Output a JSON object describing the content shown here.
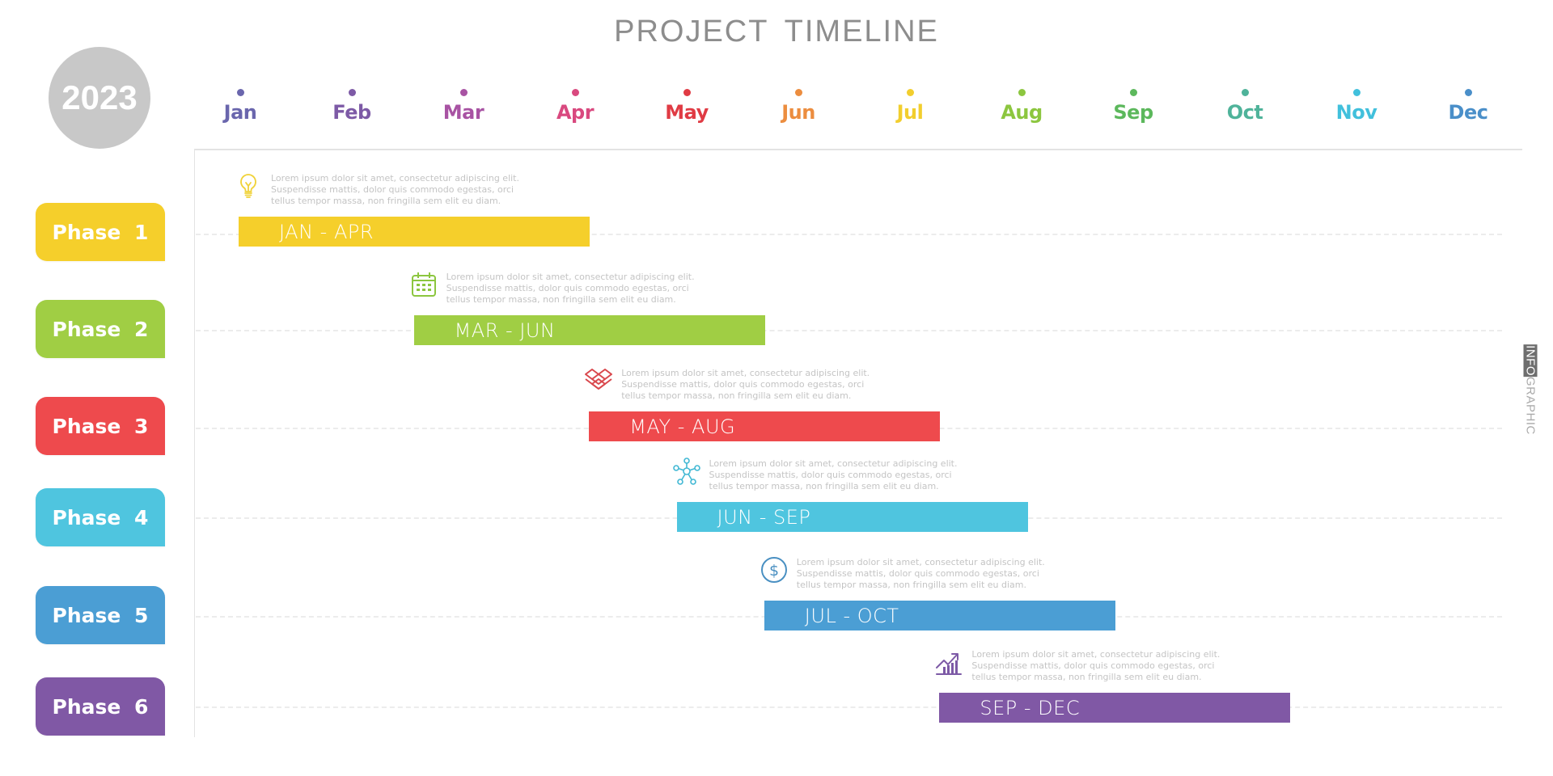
{
  "title": "PROJECT  TIMELINE",
  "year": "2023",
  "side_tag": {
    "highlight": "INFO",
    "rest": "GRAPHIC"
  },
  "months": [
    {
      "label": "Jan",
      "color": "#6a66ad"
    },
    {
      "label": "Feb",
      "color": "#7d5aa6"
    },
    {
      "label": "Mar",
      "color": "#a853a3"
    },
    {
      "label": "Apr",
      "color": "#d9497f"
    },
    {
      "label": "May",
      "color": "#e03b44"
    },
    {
      "label": "Jun",
      "color": "#ec8d3f"
    },
    {
      "label": "Jul",
      "color": "#f2ce2e"
    },
    {
      "label": "Aug",
      "color": "#8cc63f"
    },
    {
      "label": "Sep",
      "color": "#5cb85c"
    },
    {
      "label": "Oct",
      "color": "#4fb39a"
    },
    {
      "label": "Nov",
      "color": "#41c0dc"
    },
    {
      "label": "Dec",
      "color": "#4a8fc9"
    }
  ],
  "phases": [
    {
      "label": "Phase  1",
      "range_label": "JAN - APR",
      "start_month": 1,
      "end_month": 4,
      "color": "#f5cf2b",
      "icon": "lightbulb-icon",
      "icon_color": "#f0d23a",
      "description": [
        "Lorem ipsum dolor sit amet, consectetur adipiscing elit.",
        "Suspendisse mattis, dolor quis commodo egestas, orci",
        "tellus tempor massa, non fringilla sem elit eu diam."
      ]
    },
    {
      "label": "Phase  2",
      "range_label": "MAR - JUN",
      "start_month": 3,
      "end_month": 6,
      "color": "#a0ce44",
      "icon": "calendar-icon",
      "icon_color": "#8cc63f",
      "description": [
        "Lorem ipsum dolor sit amet, consectetur adipiscing elit.",
        "Suspendisse mattis, dolor quis commodo egestas, orci",
        "tellus tempor massa, non fringilla sem elit eu diam."
      ]
    },
    {
      "label": "Phase  3",
      "range_label": "MAY - AUG",
      "start_month": 5,
      "end_month": 8,
      "color": "#ee4a4d",
      "icon": "layers-icon",
      "icon_color": "#d9474c",
      "description": [
        "Lorem ipsum dolor sit amet, consectetur adipiscing elit.",
        "Suspendisse mattis, dolor quis commodo egestas, orci",
        "tellus tempor massa, non fringilla sem elit eu diam."
      ]
    },
    {
      "label": "Phase  4",
      "range_label": "JUN - SEP",
      "start_month": 6,
      "end_month": 9,
      "color": "#4fc5df",
      "icon": "network-icon",
      "icon_color": "#41b8d4",
      "description": [
        "Lorem ipsum dolor sit amet, consectetur adipiscing elit.",
        "Suspendisse mattis, dolor quis commodo egestas, orci",
        "tellus tempor massa, non fringilla sem elit eu diam."
      ]
    },
    {
      "label": "Phase  5",
      "range_label": "JUL - OCT",
      "start_month": 7,
      "end_month": 10,
      "color": "#4b9ed4",
      "icon": "dollar-icon",
      "icon_color": "#4a90c2",
      "description": [
        "Lorem ipsum dolor sit amet, consectetur adipiscing elit.",
        "Suspendisse mattis, dolor quis commodo egestas, orci",
        "tellus tempor massa, non fringilla sem elit eu diam."
      ]
    },
    {
      "label": "Phase  6",
      "range_label": "SEP - DEC",
      "start_month": 9,
      "end_month": 12,
      "color": "#8058a5",
      "icon": "growth-chart-icon",
      "icon_color": "#7d5aa6",
      "description": [
        "Lorem ipsum dolor sit amet, consectetur adipiscing elit.",
        "Suspendisse mattis, dolor quis commodo egestas, orci",
        "tellus tempor massa, non fringilla sem elit eu diam."
      ]
    }
  ],
  "chart_data": {
    "type": "gantt",
    "title": "PROJECT TIMELINE",
    "year": "2023",
    "x": [
      "Jan",
      "Feb",
      "Mar",
      "Apr",
      "May",
      "Jun",
      "Jul",
      "Aug",
      "Sep",
      "Oct",
      "Nov",
      "Dec"
    ],
    "categories": [
      "Phase 1",
      "Phase 2",
      "Phase 3",
      "Phase 4",
      "Phase 5",
      "Phase 6"
    ],
    "series": [
      {
        "name": "Phase 1",
        "start": "Jan",
        "end": "Apr",
        "label": "JAN - APR"
      },
      {
        "name": "Phase 2",
        "start": "Mar",
        "end": "Jun",
        "label": "MAR - JUN"
      },
      {
        "name": "Phase 3",
        "start": "May",
        "end": "Aug",
        "label": "MAY - AUG"
      },
      {
        "name": "Phase 4",
        "start": "Jun",
        "end": "Sep",
        "label": "JUN - SEP"
      },
      {
        "name": "Phase 5",
        "start": "Jul",
        "end": "Oct",
        "label": "JUL - OCT"
      },
      {
        "name": "Phase 6",
        "start": "Sep",
        "end": "Dec",
        "label": "SEP - DEC"
      }
    ],
    "grid": "dashed horizontal row lines",
    "legend": "none"
  }
}
